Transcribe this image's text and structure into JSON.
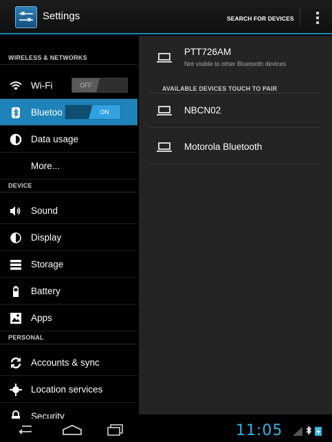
{
  "actionbar": {
    "title": "Settings",
    "search_label": "SEARCH FOR DEVICES",
    "app_icon": "settings-icon",
    "overflow_icon": "overflow-menu-icon"
  },
  "sidebar": {
    "sections": [
      {
        "label": "WIRELESS & NETWORKS"
      },
      {
        "label": "DEVICE"
      },
      {
        "label": "PERSONAL"
      }
    ],
    "items": [
      {
        "label": "Wi-Fi",
        "icon": "wifi-icon",
        "toggle": "OFF"
      },
      {
        "label": "Bluetoo",
        "icon": "bluetooth-icon",
        "toggle": "ON",
        "selected": true
      },
      {
        "label": "Data usage",
        "icon": "data-usage-icon"
      },
      {
        "label": "More...",
        "icon": ""
      },
      {
        "label": "Sound",
        "icon": "sound-icon"
      },
      {
        "label": "Display",
        "icon": "display-icon"
      },
      {
        "label": "Storage",
        "icon": "storage-icon"
      },
      {
        "label": "Battery",
        "icon": "battery-icon"
      },
      {
        "label": "Apps",
        "icon": "apps-icon"
      },
      {
        "label": "Accounts & sync",
        "icon": "sync-icon"
      },
      {
        "label": "Location services",
        "icon": "location-icon"
      },
      {
        "label": "Security",
        "icon": "lock-icon"
      }
    ]
  },
  "bluetooth": {
    "paired_device": {
      "name": "PTT726AM",
      "status": "Not visible to other Bluetooth devices"
    },
    "available_header": "AVAILABLE DEVICES  TOUCH TO PAIR",
    "devices": [
      {
        "name": "NBCN02",
        "icon": "laptop-icon"
      },
      {
        "name": "Motorola Bluetooth",
        "icon": "laptop-icon"
      }
    ]
  },
  "navbar": {
    "time": "11:05",
    "back_icon": "back-icon",
    "home_icon": "home-icon",
    "recent_icon": "recent-apps-icon"
  },
  "colors": {
    "accent": "#33b5e5",
    "selected": "#1e83b8",
    "pane": "#242424"
  }
}
